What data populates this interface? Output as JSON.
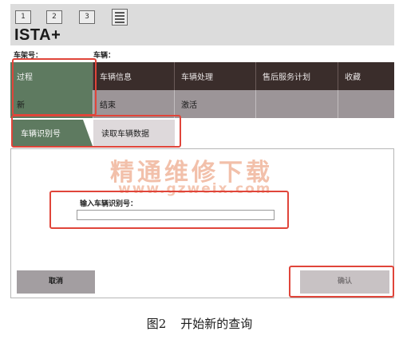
{
  "toolbar": {
    "buttons": [
      "1",
      "2",
      "3"
    ]
  },
  "app": {
    "title": "ISTA+"
  },
  "info": {
    "chassis_label": "车架号：",
    "vehicle_label": "车辆："
  },
  "menu": {
    "top": [
      "过程",
      "车辆信息",
      "车辆处理",
      "售后服务计划",
      "收藏"
    ],
    "bottom": [
      "新",
      "结束",
      "激活"
    ]
  },
  "subtabs": [
    "车辆识别号",
    "读取车辆数据"
  ],
  "form": {
    "vin_label": "输入车辆识别号：",
    "vin_value": ""
  },
  "buttons": {
    "cancel": "取消",
    "confirm": "确认"
  },
  "watermark": {
    "text": "精通维修下载",
    "url": "www.gzweix.com"
  },
  "caption": {
    "number": "图2",
    "text": "开始新的查询"
  },
  "colors": {
    "accent": "#5e7a60",
    "menu_dark": "#3a2d2b",
    "highlight": "#e0453a"
  }
}
